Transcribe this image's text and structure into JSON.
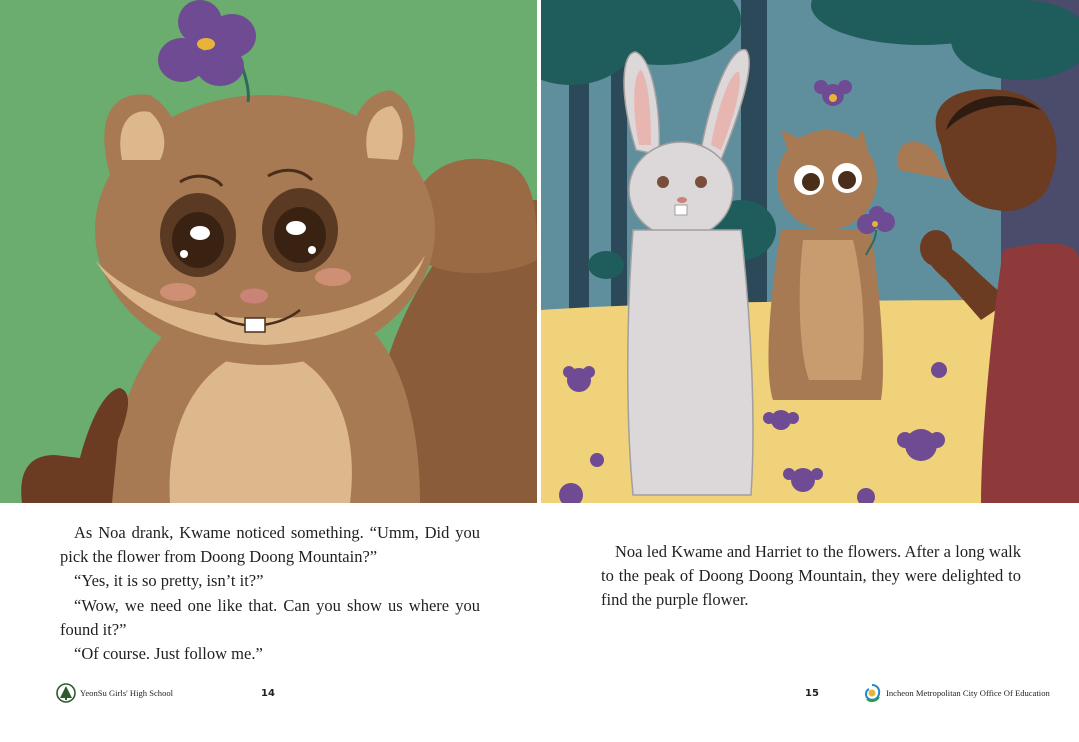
{
  "left_page": {
    "paragraphs": [
      "As Noa drank, Kwame noticed something. “Umm, Did you pick the flower from Doong Doong Mountain?”",
      "“Yes, it is so pretty, isn’t it?”",
      "“Wow, we need one like that. Can you show us where you found it?”",
      "“Of course. Just follow me.”"
    ],
    "page_number": "14",
    "footer_label": "YeonSu Girls' High School",
    "footer_icon": "school-emblem-icon"
  },
  "right_page": {
    "paragraphs": [
      "Noa led Kwame and Harriet to the flowers. After a long walk to the peak of Doong Doong Mountain, they were delighted to find the purple flower."
    ],
    "page_number": "15",
    "footer_label": "Incheon Metropolitan City Office Of Education",
    "footer_icon": "education-office-logo-icon"
  },
  "colors": {
    "left_background": "#6aad6e",
    "squirrel_fur": "#a87a53",
    "squirrel_light": "#ddb88d",
    "flower_purple": "#6e4b93",
    "meadow_yellow": "#f0d27a",
    "forest_blue": "#5f8f9c",
    "tree_dark": "#1f5d5c",
    "rabbit_grey": "#dcd7d8",
    "dress_red": "#8e3a3a",
    "skin_brown": "#6b3b22"
  }
}
